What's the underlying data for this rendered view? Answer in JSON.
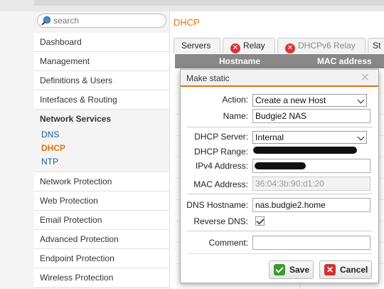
{
  "search": {
    "placeholder": "search"
  },
  "sidebar": {
    "items": [
      {
        "label": "Dashboard"
      },
      {
        "label": "Management"
      },
      {
        "label": "Definitions & Users"
      },
      {
        "label": "Interfaces & Routing"
      }
    ],
    "section": {
      "label": "Network Services",
      "subitems": [
        {
          "label": "DNS"
        },
        {
          "label": "DHCP"
        },
        {
          "label": "NTP"
        }
      ]
    },
    "items_after": [
      {
        "label": "Network Protection"
      },
      {
        "label": "Web Protection"
      },
      {
        "label": "Email Protection"
      },
      {
        "label": "Advanced Protection"
      },
      {
        "label": "Endpoint Protection"
      },
      {
        "label": "Wireless Protection"
      }
    ]
  },
  "page": {
    "title": "DHCP"
  },
  "tabs": [
    {
      "label": "Servers"
    },
    {
      "label": "Relay"
    },
    {
      "label": "DHCPv6 Relay"
    },
    {
      "label": "St"
    }
  ],
  "table": {
    "headers": [
      "Hostname",
      "MAC address"
    ]
  },
  "dialog": {
    "title": "Make static",
    "close_icon": "close-icon",
    "fields": {
      "action": {
        "label": "Action:",
        "value": "Create a new Host"
      },
      "name": {
        "label": "Name:",
        "value": "Budgie2 NAS"
      },
      "dhcp_server": {
        "label": "DHCP Server:",
        "value": "Internal"
      },
      "dhcp_range": {
        "label": "DHCP Range:"
      },
      "ipv4": {
        "label": "IPv4 Address:"
      },
      "mac": {
        "label": "MAC Address:",
        "value": "36:04:3b:90:d1:20"
      },
      "dns_hostname": {
        "label": "DNS Hostname:",
        "value": "nas.budgie2.home"
      },
      "reverse_dns": {
        "label": "Reverse DNS:",
        "checked": true
      },
      "comment": {
        "label": "Comment:",
        "value": ""
      }
    },
    "buttons": {
      "save": "Save",
      "cancel": "Cancel"
    }
  },
  "colors": {
    "accent": "#e07410",
    "link": "#1a5d9a",
    "ok": "#3a9a2d",
    "danger": "#d0312d"
  }
}
